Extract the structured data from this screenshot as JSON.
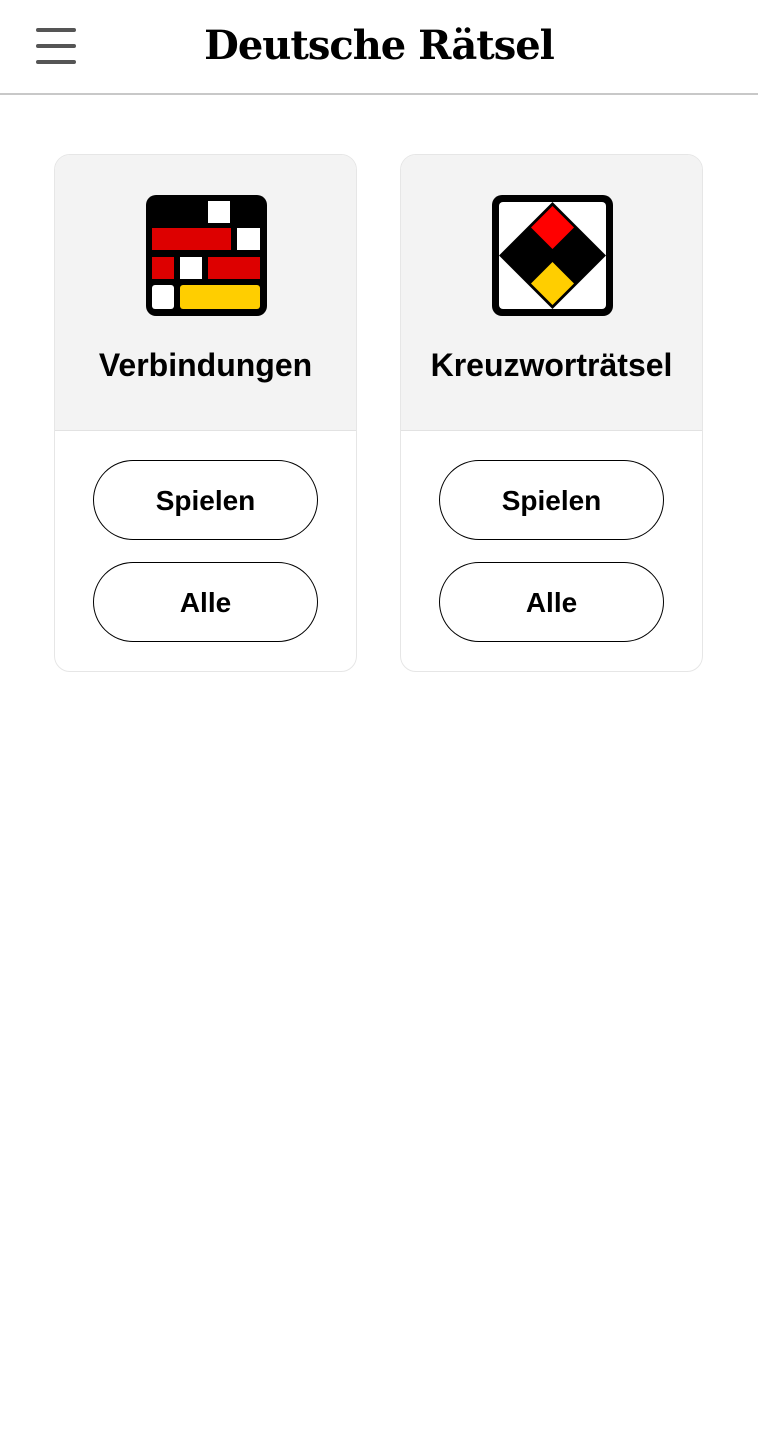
{
  "header": {
    "title": "Deutsche Rätsel",
    "menu_icon": "hamburger-menu-icon"
  },
  "games": [
    {
      "title": "Verbindungen",
      "icon": "connections-grid-icon",
      "play_label": "Spielen",
      "all_label": "Alle"
    },
    {
      "title": "Kreuzworträtsel",
      "icon": "crossword-diamond-icon",
      "play_label": "Spielen",
      "all_label": "Alle"
    }
  ],
  "colors": {
    "black": "#000000",
    "red": "#dd0000",
    "gold": "#ffce00",
    "card_top_bg": "#f3f3f3",
    "divider": "#c8c8c8"
  }
}
